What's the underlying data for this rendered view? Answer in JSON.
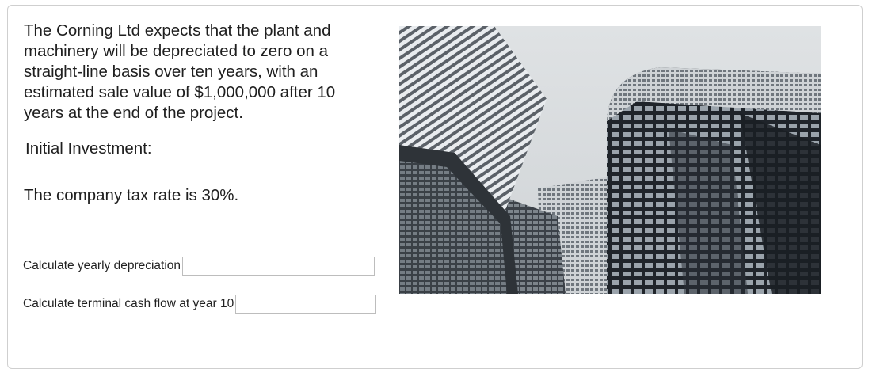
{
  "question": {
    "intro": "The Corning Ltd expects that the plant and machinery will be depreciated to zero on a straight-line basis over ten years, with an estimated sale value of $1,000,000 after 10 years at the end of the project.",
    "initial_investment": "Initial Investment:",
    "tax_rate": "The company tax rate is 30%."
  },
  "fields": [
    {
      "label": "Calculate yearly depreciation",
      "value": ""
    },
    {
      "label": "Calculate terminal cash flow at year 10",
      "value": ""
    }
  ],
  "image": {
    "subject": "skyscrapers-photo"
  }
}
